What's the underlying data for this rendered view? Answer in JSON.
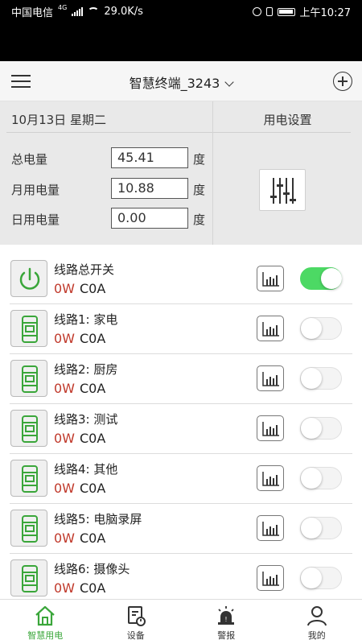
{
  "status_bar": {
    "carrier": "中国电信",
    "network": "4G",
    "speed": "29.0K/s",
    "time": "上午10:27"
  },
  "header": {
    "title": "智慧终端_3243"
  },
  "summary": {
    "date": "10月13日 星期二",
    "settings_title": "用电设置",
    "rows": [
      {
        "label": "总电量",
        "value": "45.41",
        "unit": "度"
      },
      {
        "label": "月用电量",
        "value": "10.88",
        "unit": "度"
      },
      {
        "label": "日用电量",
        "value": "0.00",
        "unit": "度"
      }
    ]
  },
  "circuits": [
    {
      "name": "线路总开关",
      "power": "0W",
      "current": "C0A",
      "on": true,
      "icon": "power-icon"
    },
    {
      "name": "线路1: 家电",
      "power": "0W",
      "current": "C0A",
      "on": false,
      "icon": "breaker-icon"
    },
    {
      "name": "线路2: 厨房",
      "power": "0W",
      "current": "C0A",
      "on": false,
      "icon": "breaker-icon"
    },
    {
      "name": "线路3: 测试",
      "power": "0W",
      "current": "C0A",
      "on": false,
      "icon": "breaker-icon"
    },
    {
      "name": "线路4: 其他",
      "power": "0W",
      "current": "C0A",
      "on": false,
      "icon": "breaker-icon"
    },
    {
      "name": "线路5: 电脑录屏",
      "power": "0W",
      "current": "C0A",
      "on": false,
      "icon": "breaker-icon"
    },
    {
      "name": "线路6: 摄像头",
      "power": "0W",
      "current": "C0A",
      "on": false,
      "icon": "breaker-icon"
    }
  ],
  "tabs": [
    {
      "label": "智慧用电",
      "icon": "home-icon",
      "active": true
    },
    {
      "label": "设备",
      "icon": "device-icon",
      "active": false
    },
    {
      "label": "警报",
      "icon": "alarm-icon",
      "active": false
    },
    {
      "label": "我的",
      "icon": "user-icon",
      "active": false
    }
  ],
  "colors": {
    "accent_green": "#4cd964",
    "power_red": "#c0392b",
    "tab_active": "#3aa63a"
  }
}
